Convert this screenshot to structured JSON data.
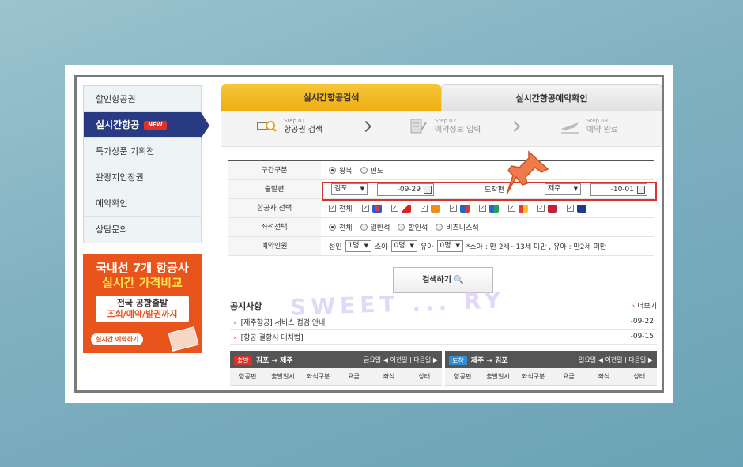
{
  "sidebar": {
    "items": [
      {
        "label": "할인항공권"
      },
      {
        "label": "실시간항공",
        "badge": "NEW"
      },
      {
        "label": "특가상품 기획전"
      },
      {
        "label": "관광지입장권"
      },
      {
        "label": "예약확인"
      },
      {
        "label": "상담문의"
      }
    ]
  },
  "banner": {
    "line1": "국내선 7개 항공사",
    "line2": "실시간 가격비교",
    "box_line1": "전국 공항출발",
    "box_line2": "조회/예약/발권까지",
    "button": "실시간 예약하기"
  },
  "tabs": [
    {
      "label": "실시간항공검색",
      "active": true
    },
    {
      "label": "실시간항공예약확인",
      "active": false
    }
  ],
  "steps": [
    {
      "no": "Step 01",
      "label": "항공권 검색"
    },
    {
      "no": "Step 02",
      "label": "예약정보 입력"
    },
    {
      "no": "Step 03",
      "label": "예약 완료"
    }
  ],
  "form": {
    "trip_label": "구간구분",
    "trip_round": "왕복",
    "trip_oneway": "편도",
    "depart_label": "출발편",
    "depart_city": "김포",
    "depart_date": "-09-29",
    "arrive_label": "도착편",
    "arrive_city": "제주",
    "arrive_date": "-10-01",
    "airline_label": "항공사 선택",
    "airline_all": "전체",
    "seat_label": "좌석선택",
    "seat_options": [
      "전체",
      "일반석",
      "할인석",
      "비즈니스석"
    ],
    "pax_label": "예약인원",
    "adult_label": "성인",
    "adult_value": "1명",
    "child_label": "소아",
    "child_value": "0명",
    "infant_label": "유아",
    "infant_value": "0명",
    "pax_note": "*소아 : 만 2세~13세 미만 , 유아 : 만2세 미만"
  },
  "search_button": "검색하기",
  "notice": {
    "title": "공지사항",
    "more": "더보기",
    "items": [
      {
        "text": "[제주항공] 서비스 점검 안내",
        "date": "-09-22"
      },
      {
        "text": "[항공 결항시 대처법]",
        "date": "-09-15"
      }
    ]
  },
  "results": {
    "outbound": {
      "tag": "출발",
      "route": "김포 → 제주",
      "nav": "금요일 ◀ 이전일 | 다음일 ▶"
    },
    "inbound": {
      "tag": "도착",
      "route": "제주 → 김포",
      "nav": "일요일 ◀ 이전일 | 다음일 ▶"
    },
    "columns": [
      "항공편",
      "출발일시",
      "좌석구분",
      "요금",
      "좌석",
      "상태"
    ]
  },
  "watermark": "SWEET ... RY",
  "colors": {
    "nav_active": "#283a82",
    "tab_active": "#f2b51e",
    "highlight": "#d9312b",
    "banner": "#e8541c"
  }
}
